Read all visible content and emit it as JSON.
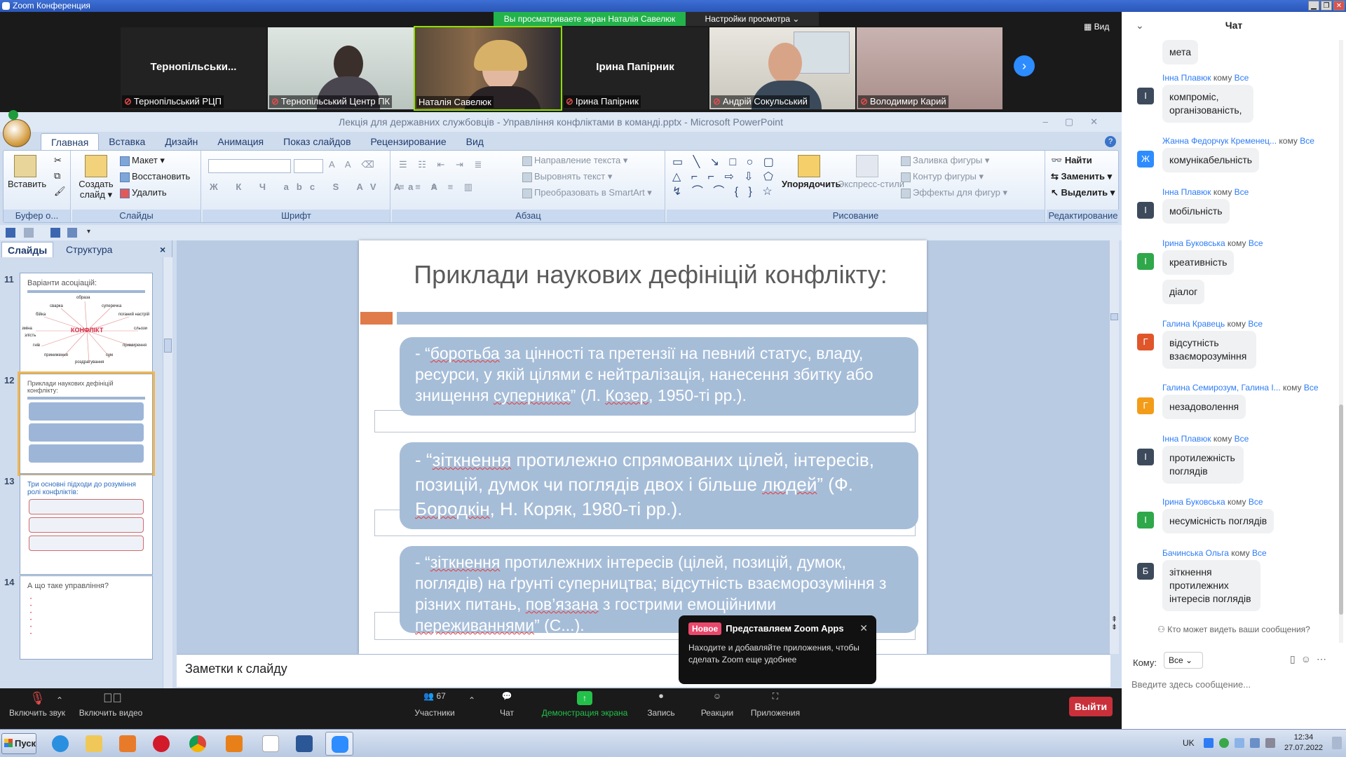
{
  "titlebar": {
    "title": "Zoom Конференция"
  },
  "zoom_top": {
    "share_banner": "Вы просматриваете экран Наталія Савелюк",
    "view_settings": "Настройки просмотра ⌄",
    "view_button": "Вид",
    "participants": [
      {
        "name_large": "Тернопільськи...",
        "label": "Тернопільський РЦП",
        "muted": true
      },
      {
        "name_large": "",
        "label": "Тернопільський Центр ПК",
        "muted": true
      },
      {
        "name_large": "",
        "label": "Наталія Савелюк",
        "muted": false
      },
      {
        "name_large": "Ірина Папірник",
        "label": "Ірина Папірник",
        "muted": true
      },
      {
        "name_large": "",
        "label": "Андрій Сокульський",
        "muted": true
      },
      {
        "name_large": "",
        "label": "Володимир Карий",
        "muted": true
      }
    ]
  },
  "ppt": {
    "window_title": "Лекція для державних службовців - Управління конфліктами в команді.pptx - Microsoft PowerPoint",
    "tabs": [
      "Главная",
      "Вставка",
      "Дизайн",
      "Анимация",
      "Показ слайдов",
      "Рецензирование",
      "Вид"
    ],
    "ribbon": {
      "clipboard": {
        "paste": "Вставить",
        "label": "Буфер о..."
      },
      "slides": {
        "create": "Создать слайд",
        "layout": "Макет",
        "reset": "Восстановить",
        "delete": "Удалить",
        "label": "Слайды"
      },
      "font": {
        "label": "Шрифт"
      },
      "paragraph": {
        "text_direction": "Направление текста",
        "align_text": "Выровнять текст",
        "smartart": "Преобразовать в SmartArt",
        "label": "Абзац"
      },
      "drawing": {
        "arrange": "Упорядочить",
        "quick_styles": "Экспресс-стили",
        "fill": "Заливка фигуры",
        "outline": "Контур фигуры",
        "effects": "Эффекты для фигур",
        "label": "Рисование"
      },
      "editing": {
        "find": "Найти",
        "replace": "Заменить",
        "select": "Выделить",
        "label": "Редактирование"
      }
    },
    "left_tabs": {
      "slides": "Слайды",
      "outline": "Структура"
    },
    "thumbnails": [
      {
        "num": "11",
        "title": "Варіанти асоціацій:",
        "center": "КОНФЛІКТ",
        "words": [
          "образа",
          "сварка",
          "суперечка",
          "бійка",
          "поганий настрій",
          "зміна",
          "злість",
          "сльози",
          "гнів",
          "примирення",
          "приниження",
          "сум",
          "роздратування"
        ]
      },
      {
        "num": "12",
        "title": "Приклади наукових дефініцій конфлікту:"
      },
      {
        "num": "13",
        "title": "Три основні підходи до розуміння ролі конфліктів:"
      },
      {
        "num": "14",
        "title": "А що таке управління?"
      }
    ],
    "slide": {
      "title": "Приклади наукових дефініцій конфлікту:",
      "items": [
        {
          "parts": [
            "- “",
            "боротьба",
            " за цінності та претензії на певний статус, владу, ресурси, у якій цілями є нейтралізація, нанесення збитку або знищення ",
            "суперника",
            "” (Л. ",
            "Козер",
            ", 1950-ті рр.)."
          ]
        },
        {
          "parts": [
            "- “",
            "зіткнення",
            "  протилежно спрямованих цілей, інтересів, позицій, думок чи поглядів двох і більше ",
            "людей",
            "” (Ф. ",
            "Бородкін",
            ", Н. Коряк, 1980-ті рр.)."
          ]
        },
        {
          "parts": [
            "- “",
            "зіткнення",
            " протилежних інтересів (цілей, позицій, думок, поглядів) на ґрунті  суперництва;  відсутність взаєморозуміння з різних питань,  ",
            "пов’язана",
            " з гострими емоційними ",
            "переживаннями",
            "” (С",
            "...",
            ")."
          ]
        }
      ]
    },
    "notes_placeholder": "Заметки к слайду"
  },
  "zoom_bar": {
    "mute": "Включить звук",
    "video": "Включить видео",
    "participants": "Участники",
    "participants_count": "67",
    "chat": "Чат",
    "share": "Демонстрация экрана",
    "record": "Запись",
    "reactions": "Реакции",
    "apps": "Приложения",
    "exit": "Выйти"
  },
  "popup": {
    "badge": "Новое",
    "title": "Представляем Zoom Apps",
    "body": "Находите и добавляйте приложения, чтобы сделать Zoom еще удобнее"
  },
  "chat": {
    "title": "Чат",
    "to_word": "кому",
    "all_word": "Все",
    "messages": [
      {
        "sender": "",
        "avatar": "",
        "color": "",
        "text": "мета"
      },
      {
        "sender": "Інна Плавюк",
        "avatar": "І",
        "color": "#3d4a5c",
        "text": "компроміс, організованість,"
      },
      {
        "sender": "Жанна Федорчук Кременец...",
        "avatar": "Ж",
        "color": "#2d8cff",
        "text": "комунікабельність"
      },
      {
        "sender": "Інна Плавюк",
        "avatar": "І",
        "color": "#3d4a5c",
        "text": "мобільність"
      },
      {
        "sender": "Ірина Буковська",
        "avatar": "І",
        "color": "#2ea84a",
        "text": "креативність"
      },
      {
        "sender": "",
        "avatar": "",
        "color": "",
        "text": "діалог"
      },
      {
        "sender": "Галина Кравець",
        "avatar": "Г",
        "color": "#e0562a",
        "text": "відсутність взаєморозуміння"
      },
      {
        "sender": "Галина Семирозум, Галина І...",
        "avatar": "Г",
        "color": "#f39c1a",
        "text": "незадоволення"
      },
      {
        "sender": "Інна Плавюк",
        "avatar": "І",
        "color": "#3d4a5c",
        "text": "протилежність поглядів"
      },
      {
        "sender": "Ірина Буковська",
        "avatar": "І",
        "color": "#2ea84a",
        "text": "несумісність поглядів"
      },
      {
        "sender": "Бачинська Ольга",
        "avatar": "Б",
        "color": "#3d4a5c",
        "text": "зіткнення протилежних інтересів поглядів"
      }
    ],
    "who_sees": "Кто может видеть ваши сообщения?",
    "to_label": "Кому:",
    "to_value": "Все",
    "input_placeholder": "Введите здесь сообщение..."
  },
  "taskbar": {
    "start": "Пуск",
    "lang": "UK",
    "time": "12:34",
    "date": "27.07.2022"
  }
}
